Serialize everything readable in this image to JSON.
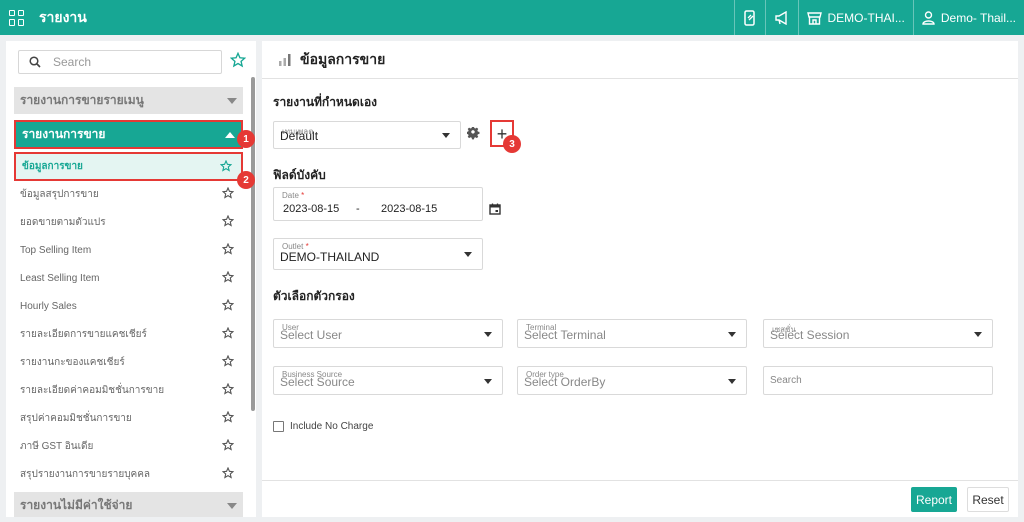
{
  "topbar": {
    "title": "รายงาน",
    "outlet_label": "DEMO-THAI...",
    "user_label": "Demo- Thail..."
  },
  "sidebar": {
    "search_placeholder": "Search",
    "groups": [
      {
        "label": "รายงานการขายรายเมนู"
      },
      {
        "label": "รายงานการขาย"
      },
      {
        "label": "รายงานไม่มีค่าใช้จ่าย"
      }
    ],
    "items": [
      {
        "label": "ข้อมูลการขาย"
      },
      {
        "label": "ข้อมูลสรุปการขาย"
      },
      {
        "label": "ยอดขายตามตัวแปร"
      },
      {
        "label": "Top Selling Item"
      },
      {
        "label": "Least Selling Item"
      },
      {
        "label": "Hourly Sales"
      },
      {
        "label": "รายละเอียดการขายแคชเชียร์"
      },
      {
        "label": "รายงานกะของแคชเชียร์"
      },
      {
        "label": "รายละเอียดค่าคอมมิชชั่นการขาย"
      },
      {
        "label": "สรุปค่าคอมมิชชั่นการขาย"
      },
      {
        "label": "ภาษี GST อินเดีย"
      },
      {
        "label": "สรุปรายงานการขายรายบุคคล"
      }
    ]
  },
  "badges": [
    "1",
    "2",
    "3"
  ],
  "main": {
    "title": "ข้อมูลการขาย",
    "custom_report_title": "รายงานที่กำหนดเอง",
    "template_label": "เทมเพลต",
    "template_value": "Default",
    "add_symbol": "+",
    "required_title": "ฟิลด์บังคับ",
    "date_label": "Date",
    "date_from": "2023-08-15",
    "date_sep": "-",
    "date_to": "2023-08-15",
    "outlet_label": "Outlet",
    "outlet_value": "DEMO-THAILAND",
    "required_mark": "*",
    "filter_title": "ตัวเลือกตัวกรอง",
    "filters": {
      "user_label": "User",
      "user_placeholder": "Select User",
      "terminal_label": "Terminal",
      "terminal_placeholder": "Select Terminal",
      "session_label": "เซสชั่น",
      "session_placeholder": "Select Session",
      "source_label": "Business Source",
      "source_placeholder": "Select Source",
      "order_label": "Order type",
      "order_placeholder": "Select OrderBy",
      "search_placeholder": "Search"
    },
    "include_no_charge": "Include No Charge",
    "report_button": "Report",
    "reset_button": "Reset"
  },
  "colors": {
    "accent": "#17a794",
    "highlight": "#e53935"
  },
  "icons": [
    "apps-icon",
    "mobile-icon",
    "megaphone-icon",
    "store-icon",
    "user-icon",
    "search-icon",
    "star-icon",
    "chart-icon",
    "gear-icon",
    "calendar-icon"
  ]
}
